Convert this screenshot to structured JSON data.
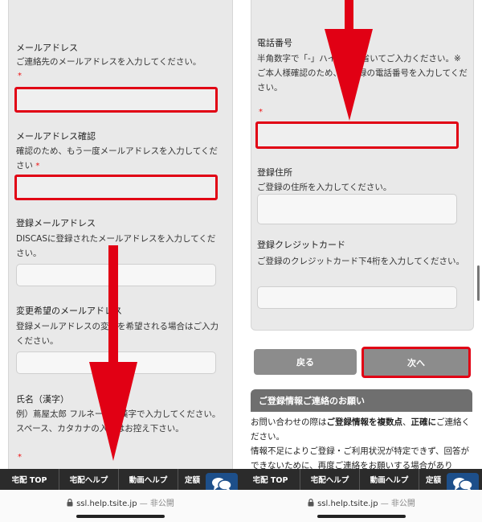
{
  "left": {
    "fields": [
      {
        "label": "メールアドレス",
        "desc": "ご連絡先のメールアドレスを入力してください。",
        "required": "*"
      },
      {
        "label": "メールアドレス確認",
        "desc": "確認のため、もう一度メールアドレスを入力してください",
        "required": "*"
      },
      {
        "label": "登録メールアドレス",
        "desc": "DISCASに登録されたメールアドレスを入力してください。"
      },
      {
        "label": "変更希望のメールアドレス",
        "desc": "登録メールアドレスの変更を希望される場合はご入力ください。"
      },
      {
        "label": "氏名（漢字）",
        "desc": "例）蔦屋太郎 フルネームを漢字で入力してください。スペース、カタカナの入力はお控え下さい。",
        "required": "*"
      }
    ]
  },
  "right": {
    "fields": [
      {
        "label": "電話番号",
        "desc": "半角数字で「-」ハイフンを省いてご入力ください。※ご本人様確認のため、ご登録の電話番号を入力してください。",
        "required": "*"
      },
      {
        "label": "登録住所",
        "desc": "ご登録の住所を入力してください。"
      },
      {
        "label": "登録クレジットカード",
        "desc": "ご登録のクレジットカード下4桁を入力してください。"
      }
    ],
    "back_label": "戻る",
    "next_label": "次へ",
    "notice": {
      "title": "ご登録情報ご連絡のお願い",
      "line1_pre": "お問い合わせの際は",
      "line1_bold1": "ご登録情報を複数点",
      "line1_mid": "、",
      "line1_bold2": "正確に",
      "line1_post": "ご連絡ください。",
      "line2": "情報不足によりご登録・ご利用状況が特定できず、回答ができないために、再度ご連絡をお願いする場合があり"
    }
  },
  "nav": {
    "items": [
      "宅配 TOP",
      "宅配ヘルプ",
      "動画ヘルプ",
      "定額"
    ]
  },
  "urlbar": {
    "domain": "ssl.help.tsite.jp",
    "privacy": " — 非公開"
  },
  "colors": {
    "highlight": "#e10014",
    "arrow": "#e10014",
    "card": "#e9e9e9",
    "nav": "#2b2b2b",
    "button": "#8c8c8c",
    "chat": "#1d4f8a"
  },
  "icons": [
    "chat-bubbles-icon",
    "lock-icon",
    "down-arrow-annotation"
  ]
}
